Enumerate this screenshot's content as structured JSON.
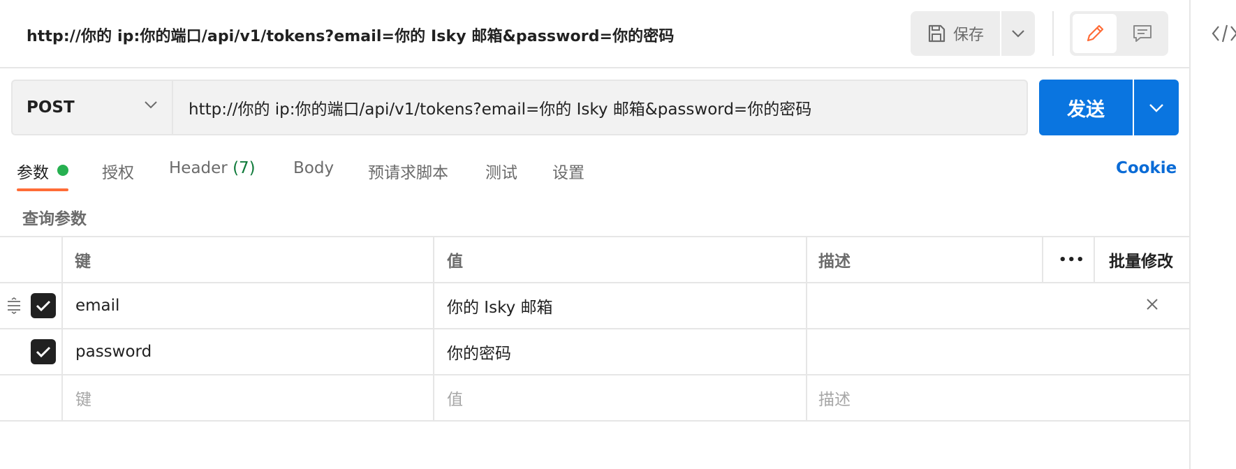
{
  "header": {
    "title": "http://你的 ip:你的端口/api/v1/tokens?email=你的 Isky 邮箱&password=你的密码",
    "save_label": "保存"
  },
  "request": {
    "method": "POST",
    "url": "http://你的 ip:你的端口/api/v1/tokens?email=你的 Isky 邮箱&password=你的密码",
    "send_label": "发送"
  },
  "tabs": [
    {
      "label": "参数"
    },
    {
      "label": "授权"
    },
    {
      "label": "Header",
      "count": "(7)"
    },
    {
      "label": "Body"
    },
    {
      "label": "预请求脚本"
    },
    {
      "label": "测试"
    },
    {
      "label": "设置"
    }
  ],
  "cookie_label": "Cookie",
  "section_label": "查询参数",
  "table": {
    "columns": {
      "key": "键",
      "value": "值",
      "description": "描述",
      "more": "•••",
      "bulk_edit": "批量修改"
    },
    "rows": [
      {
        "key": "email",
        "value": "你的 Isky 邮箱",
        "checked": true
      },
      {
        "key": "password",
        "value": "你的密码",
        "checked": true
      }
    ],
    "placeholders": {
      "key": "键",
      "value": "值",
      "description": "描述"
    }
  },
  "colors": {
    "accent": "#0a75e0",
    "tab_underline": "#ff6c37",
    "status_dot": "#26b050",
    "edit_icon": "#ff6c37"
  },
  "icons": [
    "save-icon",
    "chevron-down-icon",
    "pencil-icon",
    "comment-icon",
    "code-icon",
    "drag-handle-icon",
    "checkmark-icon",
    "close-icon"
  ]
}
